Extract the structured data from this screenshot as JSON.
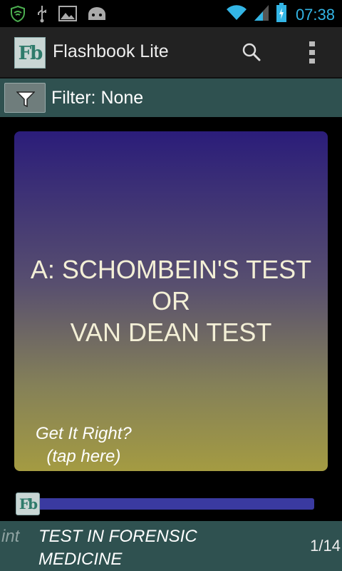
{
  "status_bar": {
    "time": "07:38",
    "icons": [
      "shield-icon",
      "usb-icon",
      "image-icon",
      "android-icon",
      "wifi-icon",
      "signal-icon",
      "battery-icon"
    ]
  },
  "action_bar": {
    "title": "Flashbook Lite",
    "logo_text": "Fb",
    "search_icon": "search-icon",
    "overflow_icon": "overflow-menu-icon"
  },
  "filter_bar": {
    "label": "Filter: None",
    "icon": "funnel-icon"
  },
  "card": {
    "answer": "A: SCHOMBEIN'S TEST\nOR\nVAN DEAN TEST",
    "prompt_line1": "Get It Right?",
    "prompt_line2": "(tap here)"
  },
  "progress": {
    "thumb_text": "Fb",
    "fraction": 0.071
  },
  "bottom_bar": {
    "hint_label": "int",
    "question": "TEST IN FORENSIC MEDICINE",
    "counter": "1/14"
  },
  "colors": {
    "accent": "#33b5e5",
    "bar_teal": "#2f5150",
    "progress": "#4448d8"
  }
}
